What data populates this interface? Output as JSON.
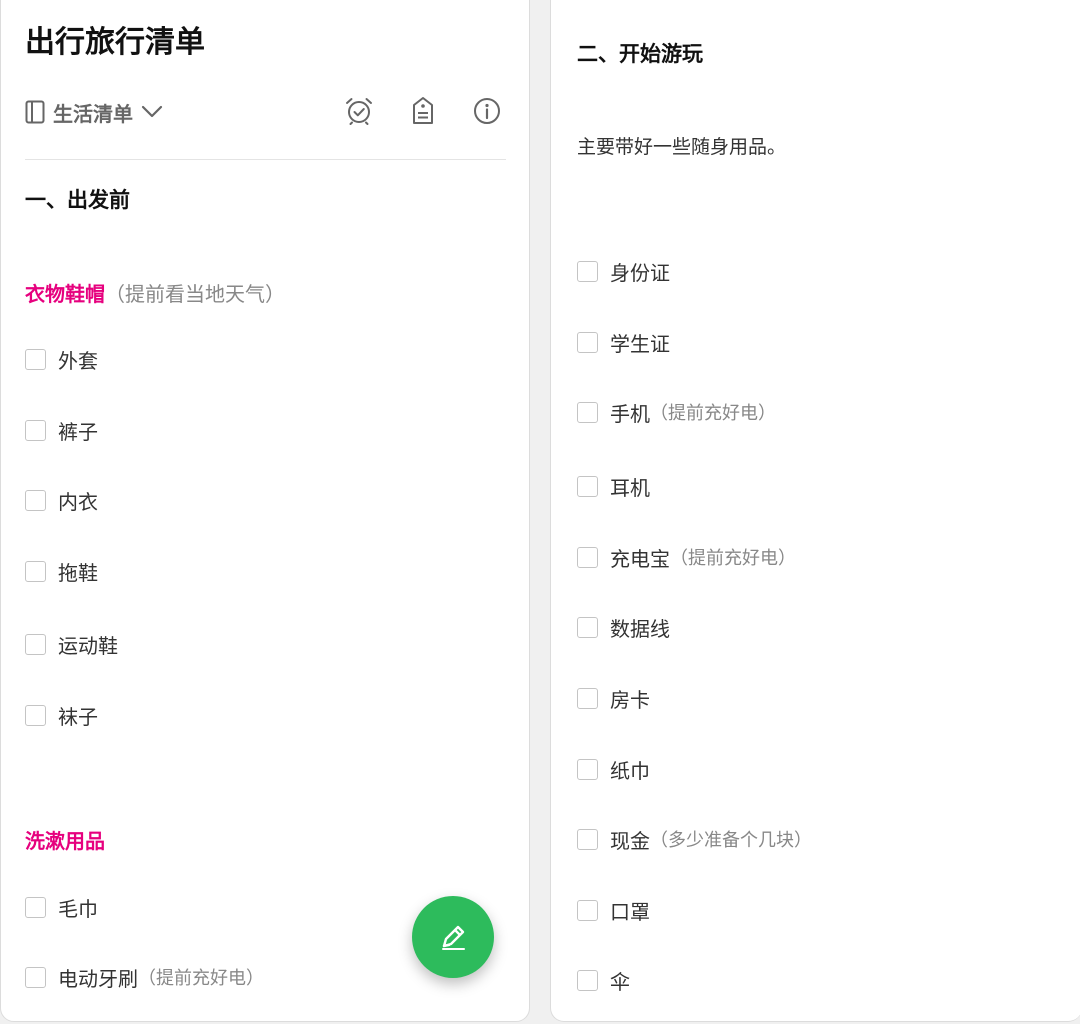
{
  "left": {
    "title": "出行旅行清单",
    "list_selector": "生活清单",
    "section1": "一、出发前",
    "group_clothes": {
      "title": "衣物鞋帽",
      "note": "（提前看当地天气）"
    },
    "clothes_items": [
      {
        "label": "外套"
      },
      {
        "label": "裤子"
      },
      {
        "label": "内衣"
      },
      {
        "label": "拖鞋"
      },
      {
        "label": "运动鞋"
      },
      {
        "label": "袜子"
      }
    ],
    "group_wash": {
      "title": "洗漱用品"
    },
    "wash_items": [
      {
        "label": "毛巾"
      },
      {
        "label": "电动牙刷",
        "note": "（提前充好电）"
      }
    ]
  },
  "icons": {
    "list": "notebook-icon",
    "dropdown": "chevron-down-icon",
    "reminder": "alarm-clock-icon",
    "tag": "tag-icon",
    "info": "info-icon",
    "edit": "pencil-icon"
  },
  "right": {
    "section2": "二、开始游玩",
    "intro": "主要带好一些随身用品。",
    "items": [
      {
        "label": "身份证"
      },
      {
        "label": "学生证"
      },
      {
        "label": "手机",
        "note": "（提前充好电）"
      },
      {
        "label": "耳机"
      },
      {
        "label": "充电宝",
        "note": "（提前充好电）"
      },
      {
        "label": "数据线"
      },
      {
        "label": "房卡"
      },
      {
        "label": "纸巾"
      },
      {
        "label": "现金",
        "note": "（多少准备个几块）"
      },
      {
        "label": "口罩"
      },
      {
        "label": "伞"
      }
    ]
  },
  "colors": {
    "accent": "#e6007e",
    "fab": "#2dbb5c",
    "muted": "#888888"
  }
}
